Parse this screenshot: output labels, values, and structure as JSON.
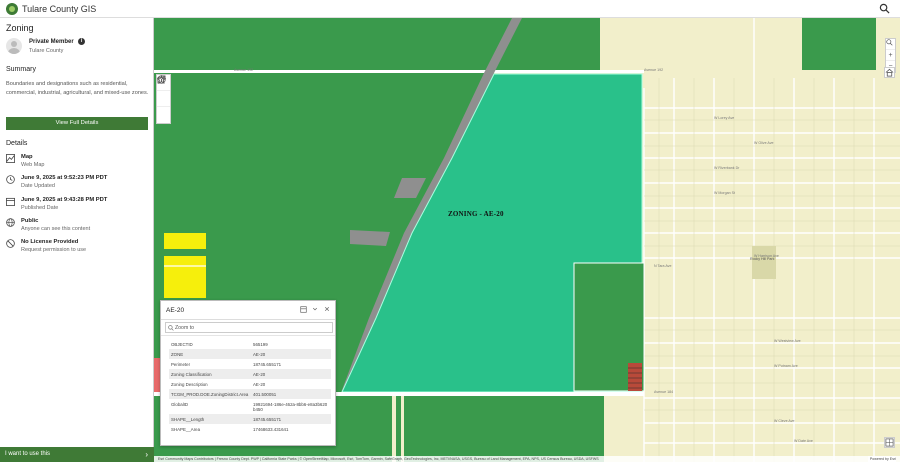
{
  "header": {
    "title": "Tulare County GIS"
  },
  "sidebar": {
    "page_title": "Zoning",
    "owner": {
      "name": "Private Member",
      "org": "Tulare County"
    },
    "summary_heading": "Summary",
    "summary_text": "Boundaries and designations such as residential, commercial, industrial, agricultural, and mixed-use zones.",
    "view_button": "View Full Details",
    "details_heading": "Details",
    "details": [
      {
        "icon": "map-icon",
        "title": "Map",
        "sub": "Web Map"
      },
      {
        "icon": "clock-icon",
        "title": "June 9, 2025 at 9:52:23 PM PDT",
        "sub": "Date Updated"
      },
      {
        "icon": "calendar-icon",
        "title": "June 9, 2025 at 9:43:28 PM PDT",
        "sub": "Published Date"
      },
      {
        "icon": "globe-icon",
        "title": "Public",
        "sub": "Anyone can see this content"
      },
      {
        "icon": "no-license-icon",
        "title": "No License Provided",
        "sub": "Request permission to use"
      }
    ],
    "want_button": "I want to use this"
  },
  "map": {
    "zoning_label": "ZONING - AE-20",
    "streets": [
      "Avenue 192",
      "Avenue 192",
      "W Lorey Ave",
      "W Olive Ave",
      "Avenue 184",
      "W Riverbank Dr",
      "Avenue 184",
      "W Morgan St",
      "W Harrison Ave",
      "N Tara Ave",
      "W Westview Ave",
      "W Putnam Ave",
      "W Cleve Ave",
      "W Date Ave"
    ],
    "park_label": "Rocky Hill Park",
    "colors": {
      "ag": "#3a9a4c",
      "highlight": "#29c18a",
      "road": "#8f8f8f",
      "yellow": "#f6ef0c",
      "residential": "#f2efcb"
    },
    "tools": [
      "info-icon",
      "bookmark-icon",
      "share-icon"
    ],
    "right_tools": [
      "search-icon",
      "zoom-in-icon",
      "zoom-out-icon"
    ]
  },
  "popup": {
    "title": "AE-20",
    "zoom_to": "Zoom to",
    "rows": [
      {
        "key": "OBJECTID",
        "value": "565199"
      },
      {
        "key": "ZONE",
        "value": "AE-20"
      },
      {
        "key": "Perimeter",
        "value": "18745.655171"
      },
      {
        "key": "Zoning Classification",
        "value": "AE-20"
      },
      {
        "key": "Zoning Description",
        "value": "AE-20"
      },
      {
        "key": "TCGM_PROD.DOE.ZoningDistrict.Area",
        "value": "401.500051"
      },
      {
        "key": "GlobalID",
        "value": "19921694-186e-462a-8bb6-e8a3b620b450"
      },
      {
        "key": "SHAPE__Length",
        "value": "18745.655171"
      },
      {
        "key": "SHAPE__Area",
        "value": "17468633.431641"
      }
    ]
  },
  "attribution": "Esri Community Maps Contributors | Fresno County Dept. PWP | California State Parks | © OpenStreetMap, Microsoft, Esri, TomTom, Garmin, SafeGraph, GeoTechnologies, Inc, METI/NASA, USGS, Bureau of Land Management, EPA, NPS, US Census Bureau, USDA, USFWS",
  "powered_by": "Powered by Esri"
}
